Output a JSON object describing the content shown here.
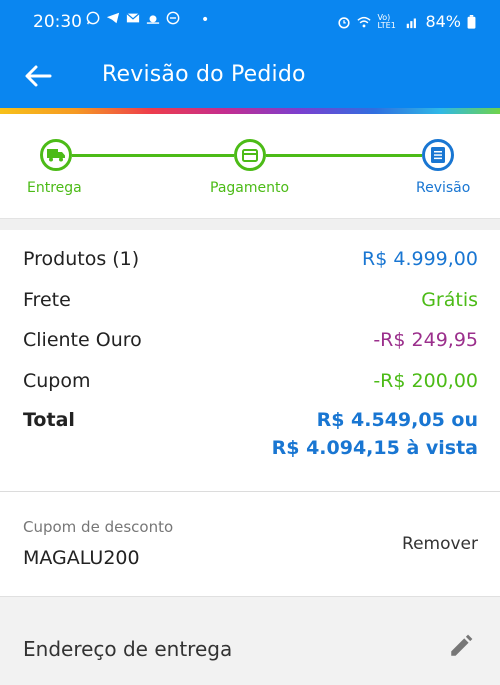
{
  "status_bar": {
    "time": "20:30",
    "dot": "•",
    "battery": "84%",
    "network": "Vo) LTE1",
    "icons_left": [
      "whatsapp-icon",
      "telegram-icon",
      "mail-icon",
      "weather-icon",
      "do-not-disturb-icon"
    ],
    "icons_right": [
      "alarm-icon",
      "wifi-icon",
      "signal-icon",
      "battery-icon"
    ]
  },
  "app_bar": {
    "title": "Revisão do Pedido",
    "back_icon": "arrow-back-icon"
  },
  "colors": {
    "primary": "#0a86f0",
    "step_green": "#4cbb17",
    "step_blue": "#1976d2",
    "price_blue": "#1976d2",
    "discount_purple": "#9b2f8c"
  },
  "stepper": {
    "steps": [
      {
        "label": "Entrega",
        "icon": "truck-icon",
        "state": "done"
      },
      {
        "label": "Pagamento",
        "icon": "card-icon",
        "state": "done"
      },
      {
        "label": "Revisão",
        "icon": "receipt-icon",
        "state": "current"
      }
    ]
  },
  "summary": {
    "products_label": "Produtos (1)",
    "products_value": "R$ 4.999,00",
    "shipping_label": "Frete",
    "shipping_value": "Grátis",
    "gold_label": "Cliente Ouro",
    "gold_value": "-R$ 249,95",
    "coupon_label": "Cupom",
    "coupon_value": "-R$ 200,00",
    "total_label": "Total",
    "total_value_line1": "R$ 4.549,05 ou",
    "total_value_line2": "R$ 4.094,15 à vista"
  },
  "coupon": {
    "label": "Cupom de desconto",
    "code": "MAGALU200",
    "remove_label": "Remover"
  },
  "address": {
    "title": "Endereço de entrega",
    "edit_icon": "pencil-icon"
  }
}
